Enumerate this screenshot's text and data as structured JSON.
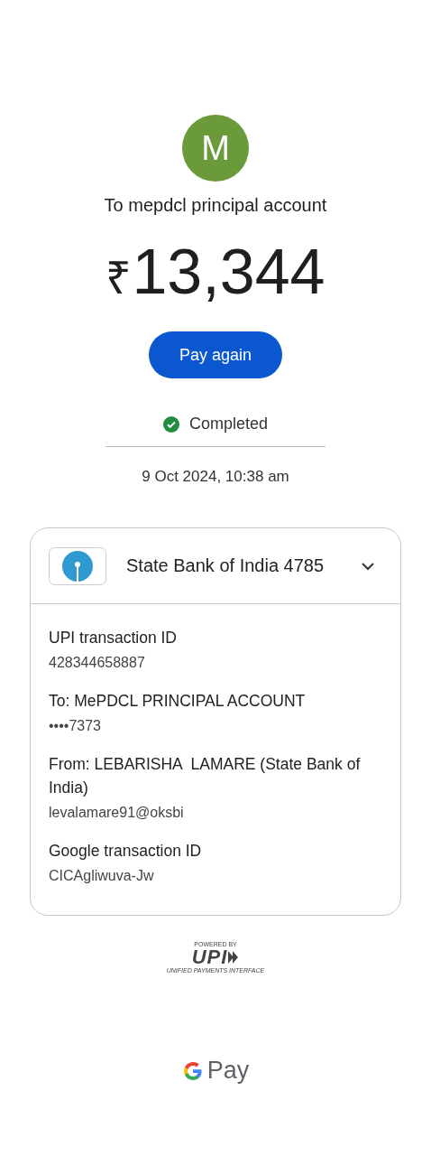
{
  "payee": {
    "initial": "M",
    "title": "To mepdcl principal account"
  },
  "amount": {
    "currency": "₹",
    "value": "13,344"
  },
  "action": {
    "label": "Pay again"
  },
  "status": {
    "label": "Completed",
    "kind": "success"
  },
  "timestamp": "9 Oct 2024, 10:38 am",
  "card": {
    "bank": "State Bank of India 4785",
    "expanded": true,
    "details": [
      {
        "label": "UPI transaction ID",
        "value": "428344658887"
      },
      {
        "label": "To: MePDCL PRINCIPAL ACCOUNT",
        "value": "••••7373"
      },
      {
        "label": "From: LEBARISHA  LAMARE (State Bank of India)",
        "value": "levalamare91@oksbi"
      },
      {
        "label": "Google transaction ID",
        "value": "CICAgliwuva-Jw"
      }
    ]
  },
  "upi_badge": {
    "top": "POWERED BY",
    "mark": "UPI",
    "bottom": "UNIFIED PAYMENTS INTERFACE"
  },
  "footer": {
    "brand": "Pay"
  }
}
